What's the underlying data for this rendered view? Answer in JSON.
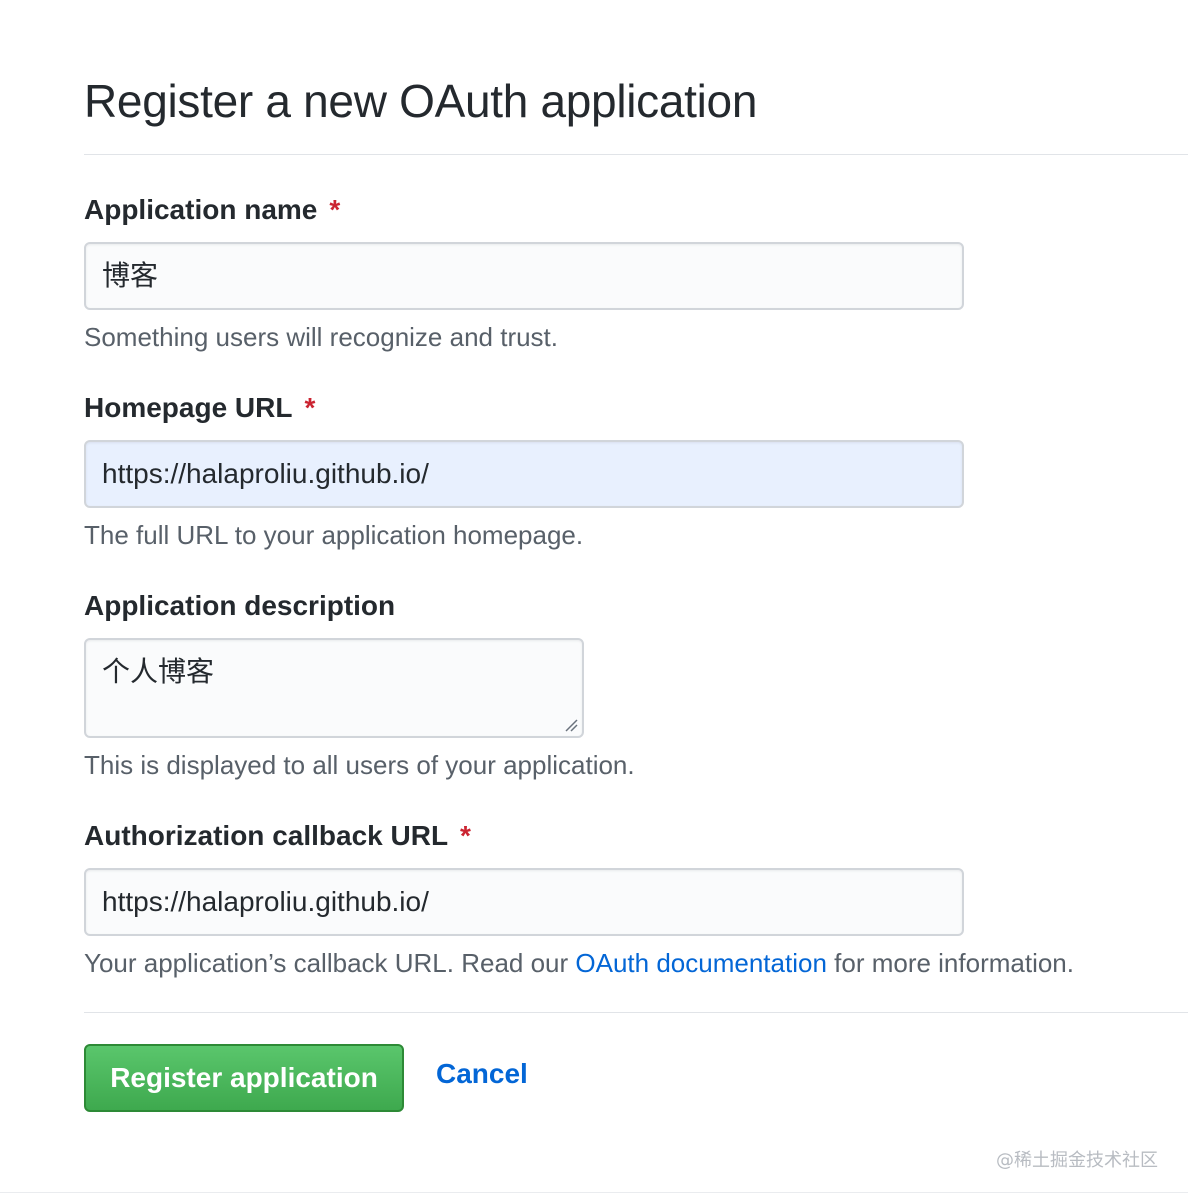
{
  "page": {
    "title": "Register a new OAuth application"
  },
  "fields": {
    "app_name": {
      "label": "Application name",
      "required_mark": "*",
      "value": "博客",
      "note": "Something users will recognize and trust."
    },
    "homepage_url": {
      "label": "Homepage URL",
      "required_mark": "*",
      "value": "https://halaproliu.github.io/",
      "note": "The full URL to your application homepage."
    },
    "description": {
      "label": "Application description",
      "value": "个人博客",
      "note": "This is displayed to all users of your application."
    },
    "callback_url": {
      "label": "Authorization callback URL",
      "required_mark": "*",
      "value": "https://halaproliu.github.io/",
      "note_before": "Your application’s callback URL. Read our ",
      "note_link": "OAuth documentation",
      "note_after": " for more information."
    }
  },
  "actions": {
    "register_label": "Register application",
    "cancel_label": "Cancel"
  },
  "watermark": "@稀土掘金技术社区",
  "colors": {
    "required": "#cb2431",
    "link": "#0366d6",
    "primary_button": "#3ea94e",
    "autofill_bg": "#e8f0fe"
  }
}
